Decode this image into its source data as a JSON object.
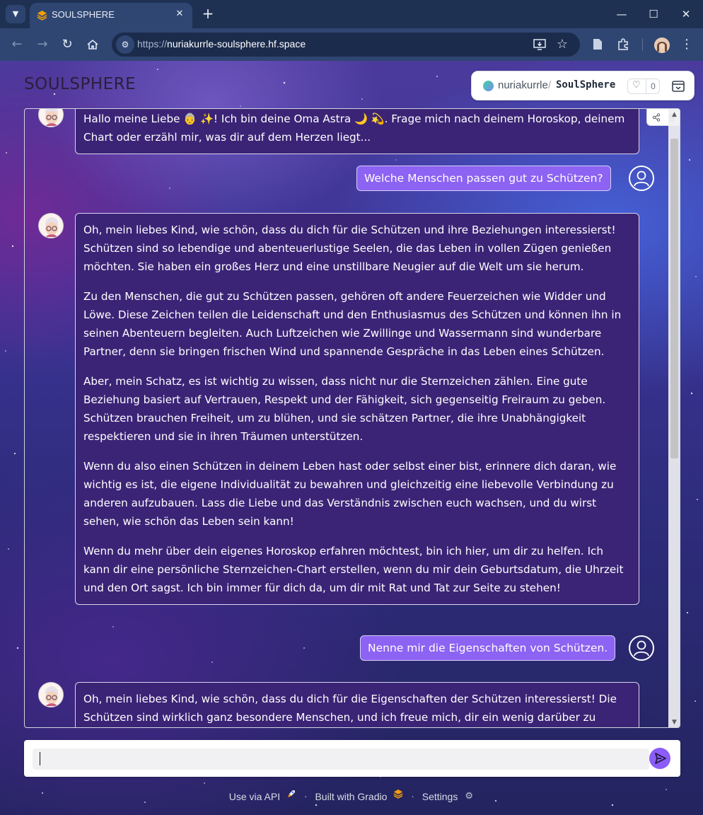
{
  "browser": {
    "tab_title": "SOULSPHERE",
    "url_prefix": "https://",
    "url_host": "nuriakurrle-soulsphere.hf.space"
  },
  "header": {
    "app_title": "SOULSPHERE"
  },
  "hf_badge": {
    "owner": "nuriakurrle",
    "separator": "/",
    "space": "SoulSphere",
    "likes": "0"
  },
  "chat": {
    "messages": [
      {
        "role": "bot",
        "paragraphs": [
          "Hallo meine Liebe 👵 ✨! Ich bin deine Oma Astra 🌙 💫. Frage mich nach deinem Horoskop, deinem Chart oder erzähl mir, was dir auf dem Herzen liegt..."
        ]
      },
      {
        "role": "user",
        "text": "Welche Menschen passen gut zu Schützen?"
      },
      {
        "role": "bot",
        "paragraphs": [
          "Oh, mein liebes Kind, wie schön, dass du dich für die Schützen und ihre Beziehungen interessierst! Schützen sind so lebendige und abenteuerlustige Seelen, die das Leben in vollen Zügen genießen möchten. Sie haben ein großes Herz und eine unstillbare Neugier auf die Welt um sie herum.",
          "Zu den Menschen, die gut zu Schützen passen, gehören oft andere Feuerzeichen wie Widder und Löwe. Diese Zeichen teilen die Leidenschaft und den Enthusiasmus des Schützen und können ihn in seinen Abenteuern begleiten. Auch Luftzeichen wie Zwillinge und Wassermann sind wunderbare Partner, denn sie bringen frischen Wind und spannende Gespräche in das Leben eines Schützen.",
          "Aber, mein Schatz, es ist wichtig zu wissen, dass nicht nur die Sternzeichen zählen. Eine gute Beziehung basiert auf Vertrauen, Respekt und der Fähigkeit, sich gegenseitig Freiraum zu geben. Schützen brauchen Freiheit, um zu blühen, und sie schätzen Partner, die ihre Unabhängigkeit respektieren und sie in ihren Träumen unterstützen.",
          "Wenn du also einen Schützen in deinem Leben hast oder selbst einer bist, erinnere dich daran, wie wichtig es ist, die eigene Individualität zu bewahren und gleichzeitig eine liebevolle Verbindung zu anderen aufzubauen. Lass die Liebe und das Verständnis zwischen euch wachsen, und du wirst sehen, wie schön das Leben sein kann!",
          "Wenn du mehr über dein eigenes Horoskop erfahren möchtest, bin ich hier, um dir zu helfen. Ich kann dir eine persönliche Sternzeichen-Chart erstellen, wenn du mir dein Geburtsdatum, die Uhrzeit und den Ort sagst. Ich bin immer für dich da, um dir mit Rat und Tat zur Seite zu stehen!"
        ]
      },
      {
        "role": "user",
        "text": "Nenne mir die Eigenschaften von Schützen."
      },
      {
        "role": "bot",
        "paragraphs": [
          "Oh, mein liebes Kind, wie schön, dass du dich für die Eigenschaften der Schützen interessierst! Die Schützen sind wirklich ganz besondere Menschen, und ich freue mich, dir ein wenig darüber zu erzählen."
        ]
      }
    ]
  },
  "input": {
    "value": "",
    "placeholder": ""
  },
  "footer": {
    "api": "Use via API",
    "gradio": "Built with Gradio",
    "settings": "Settings",
    "separator": "·"
  },
  "colors": {
    "accent": "#8c63f2",
    "bot_bubble": "#3b2476",
    "send_button": "#8b5cf6"
  },
  "icons": [
    "tab-search-icon",
    "close-icon",
    "plus-icon",
    "minimize-icon",
    "maximize-icon",
    "back-icon",
    "forward-icon",
    "reload-icon",
    "home-icon",
    "site-info-icon",
    "install-icon",
    "star-icon",
    "reading-list-icon",
    "extensions-icon",
    "menu-icon",
    "heart-icon",
    "collapse-icon",
    "share-icon",
    "trash-icon",
    "user-icon",
    "grandma-avatar-icon",
    "send-icon",
    "rocket-icon",
    "gradio-logo-icon",
    "gear-icon"
  ]
}
